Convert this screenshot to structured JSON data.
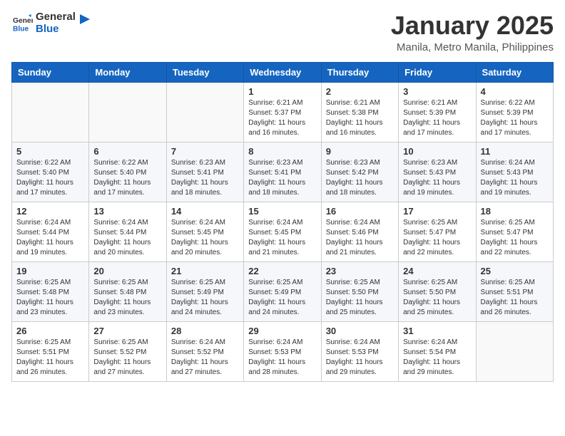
{
  "header": {
    "logo_general": "General",
    "logo_blue": "Blue",
    "month_title": "January 2025",
    "location": "Manila, Metro Manila, Philippines"
  },
  "weekdays": [
    "Sunday",
    "Monday",
    "Tuesday",
    "Wednesday",
    "Thursday",
    "Friday",
    "Saturday"
  ],
  "weeks": [
    [
      {
        "day": "",
        "sunrise": "",
        "sunset": "",
        "daylight": ""
      },
      {
        "day": "",
        "sunrise": "",
        "sunset": "",
        "daylight": ""
      },
      {
        "day": "",
        "sunrise": "",
        "sunset": "",
        "daylight": ""
      },
      {
        "day": "1",
        "sunrise": "Sunrise: 6:21 AM",
        "sunset": "Sunset: 5:37 PM",
        "daylight": "Daylight: 11 hours and 16 minutes."
      },
      {
        "day": "2",
        "sunrise": "Sunrise: 6:21 AM",
        "sunset": "Sunset: 5:38 PM",
        "daylight": "Daylight: 11 hours and 16 minutes."
      },
      {
        "day": "3",
        "sunrise": "Sunrise: 6:21 AM",
        "sunset": "Sunset: 5:39 PM",
        "daylight": "Daylight: 11 hours and 17 minutes."
      },
      {
        "day": "4",
        "sunrise": "Sunrise: 6:22 AM",
        "sunset": "Sunset: 5:39 PM",
        "daylight": "Daylight: 11 hours and 17 minutes."
      }
    ],
    [
      {
        "day": "5",
        "sunrise": "Sunrise: 6:22 AM",
        "sunset": "Sunset: 5:40 PM",
        "daylight": "Daylight: 11 hours and 17 minutes."
      },
      {
        "day": "6",
        "sunrise": "Sunrise: 6:22 AM",
        "sunset": "Sunset: 5:40 PM",
        "daylight": "Daylight: 11 hours and 17 minutes."
      },
      {
        "day": "7",
        "sunrise": "Sunrise: 6:23 AM",
        "sunset": "Sunset: 5:41 PM",
        "daylight": "Daylight: 11 hours and 18 minutes."
      },
      {
        "day": "8",
        "sunrise": "Sunrise: 6:23 AM",
        "sunset": "Sunset: 5:41 PM",
        "daylight": "Daylight: 11 hours and 18 minutes."
      },
      {
        "day": "9",
        "sunrise": "Sunrise: 6:23 AM",
        "sunset": "Sunset: 5:42 PM",
        "daylight": "Daylight: 11 hours and 18 minutes."
      },
      {
        "day": "10",
        "sunrise": "Sunrise: 6:23 AM",
        "sunset": "Sunset: 5:43 PM",
        "daylight": "Daylight: 11 hours and 19 minutes."
      },
      {
        "day": "11",
        "sunrise": "Sunrise: 6:24 AM",
        "sunset": "Sunset: 5:43 PM",
        "daylight": "Daylight: 11 hours and 19 minutes."
      }
    ],
    [
      {
        "day": "12",
        "sunrise": "Sunrise: 6:24 AM",
        "sunset": "Sunset: 5:44 PM",
        "daylight": "Daylight: 11 hours and 19 minutes."
      },
      {
        "day": "13",
        "sunrise": "Sunrise: 6:24 AM",
        "sunset": "Sunset: 5:44 PM",
        "daylight": "Daylight: 11 hours and 20 minutes."
      },
      {
        "day": "14",
        "sunrise": "Sunrise: 6:24 AM",
        "sunset": "Sunset: 5:45 PM",
        "daylight": "Daylight: 11 hours and 20 minutes."
      },
      {
        "day": "15",
        "sunrise": "Sunrise: 6:24 AM",
        "sunset": "Sunset: 5:45 PM",
        "daylight": "Daylight: 11 hours and 21 minutes."
      },
      {
        "day": "16",
        "sunrise": "Sunrise: 6:24 AM",
        "sunset": "Sunset: 5:46 PM",
        "daylight": "Daylight: 11 hours and 21 minutes."
      },
      {
        "day": "17",
        "sunrise": "Sunrise: 6:25 AM",
        "sunset": "Sunset: 5:47 PM",
        "daylight": "Daylight: 11 hours and 22 minutes."
      },
      {
        "day": "18",
        "sunrise": "Sunrise: 6:25 AM",
        "sunset": "Sunset: 5:47 PM",
        "daylight": "Daylight: 11 hours and 22 minutes."
      }
    ],
    [
      {
        "day": "19",
        "sunrise": "Sunrise: 6:25 AM",
        "sunset": "Sunset: 5:48 PM",
        "daylight": "Daylight: 11 hours and 23 minutes."
      },
      {
        "day": "20",
        "sunrise": "Sunrise: 6:25 AM",
        "sunset": "Sunset: 5:48 PM",
        "daylight": "Daylight: 11 hours and 23 minutes."
      },
      {
        "day": "21",
        "sunrise": "Sunrise: 6:25 AM",
        "sunset": "Sunset: 5:49 PM",
        "daylight": "Daylight: 11 hours and 24 minutes."
      },
      {
        "day": "22",
        "sunrise": "Sunrise: 6:25 AM",
        "sunset": "Sunset: 5:49 PM",
        "daylight": "Daylight: 11 hours and 24 minutes."
      },
      {
        "day": "23",
        "sunrise": "Sunrise: 6:25 AM",
        "sunset": "Sunset: 5:50 PM",
        "daylight": "Daylight: 11 hours and 25 minutes."
      },
      {
        "day": "24",
        "sunrise": "Sunrise: 6:25 AM",
        "sunset": "Sunset: 5:50 PM",
        "daylight": "Daylight: 11 hours and 25 minutes."
      },
      {
        "day": "25",
        "sunrise": "Sunrise: 6:25 AM",
        "sunset": "Sunset: 5:51 PM",
        "daylight": "Daylight: 11 hours and 26 minutes."
      }
    ],
    [
      {
        "day": "26",
        "sunrise": "Sunrise: 6:25 AM",
        "sunset": "Sunset: 5:51 PM",
        "daylight": "Daylight: 11 hours and 26 minutes."
      },
      {
        "day": "27",
        "sunrise": "Sunrise: 6:25 AM",
        "sunset": "Sunset: 5:52 PM",
        "daylight": "Daylight: 11 hours and 27 minutes."
      },
      {
        "day": "28",
        "sunrise": "Sunrise: 6:24 AM",
        "sunset": "Sunset: 5:52 PM",
        "daylight": "Daylight: 11 hours and 27 minutes."
      },
      {
        "day": "29",
        "sunrise": "Sunrise: 6:24 AM",
        "sunset": "Sunset: 5:53 PM",
        "daylight": "Daylight: 11 hours and 28 minutes."
      },
      {
        "day": "30",
        "sunrise": "Sunrise: 6:24 AM",
        "sunset": "Sunset: 5:53 PM",
        "daylight": "Daylight: 11 hours and 29 minutes."
      },
      {
        "day": "31",
        "sunrise": "Sunrise: 6:24 AM",
        "sunset": "Sunset: 5:54 PM",
        "daylight": "Daylight: 11 hours and 29 minutes."
      },
      {
        "day": "",
        "sunrise": "",
        "sunset": "",
        "daylight": ""
      }
    ]
  ]
}
